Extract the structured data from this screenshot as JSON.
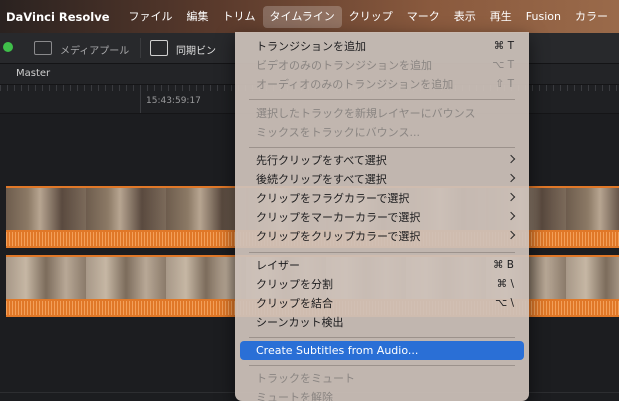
{
  "menubar": {
    "app_name": "DaVinci Resolve",
    "items": [
      "ファイル",
      "編集",
      "トリム",
      "タイムライン",
      "クリップ",
      "マーク",
      "表示",
      "再生",
      "Fusion",
      "カラー"
    ],
    "active_index": 3
  },
  "toolbar": {
    "media_pool": "メディアプール",
    "sync_bin": "同期ビン"
  },
  "timeline": {
    "name": "Master",
    "timecode": "15:43:59:17"
  },
  "menu": {
    "items": [
      {
        "label": "トランジションを追加",
        "shortcut": "⌘ T",
        "enabled": true
      },
      {
        "label": "ビデオのみのトランジションを追加",
        "shortcut": "⌥ T",
        "enabled": false
      },
      {
        "label": "オーディオのみのトランジションを追加",
        "shortcut": "⇧ T",
        "enabled": false
      },
      {
        "label": "選択したトラックを新規レイヤーにバウンス",
        "shortcut": "",
        "enabled": false
      },
      {
        "label": "ミックスをトラックにバウンス...",
        "shortcut": "",
        "enabled": false
      },
      {
        "label": "先行クリップをすべて選択",
        "shortcut": "",
        "enabled": true,
        "submenu": true
      },
      {
        "label": "後続クリップをすべて選択",
        "shortcut": "",
        "enabled": true,
        "submenu": true
      },
      {
        "label": "クリップをフラグカラーで選択",
        "shortcut": "",
        "enabled": true,
        "submenu": true
      },
      {
        "label": "クリップをマーカーカラーで選択",
        "shortcut": "",
        "enabled": true,
        "submenu": true
      },
      {
        "label": "クリップをクリップカラーで選択",
        "shortcut": "",
        "enabled": true,
        "submenu": true
      },
      {
        "label": "レイザー",
        "shortcut": "⌘ B",
        "enabled": true
      },
      {
        "label": "クリップを分割",
        "shortcut": "⌘ \\",
        "enabled": true
      },
      {
        "label": "クリップを結合",
        "shortcut": "⌥ \\",
        "enabled": true
      },
      {
        "label": "シーンカット検出",
        "shortcut": "",
        "enabled": true
      },
      {
        "label": "Create Subtitles from Audio...",
        "shortcut": "",
        "enabled": true,
        "highlighted": true
      },
      {
        "label": "トラックをミュート",
        "shortcut": "",
        "enabled": false
      },
      {
        "label": "ミュートを解除",
        "shortcut": "",
        "enabled": false
      }
    ]
  },
  "colors": {
    "accent_highlight": "#2a6fd6",
    "clip_audio": "#e07828",
    "status_dot": "#3fbf4a"
  }
}
